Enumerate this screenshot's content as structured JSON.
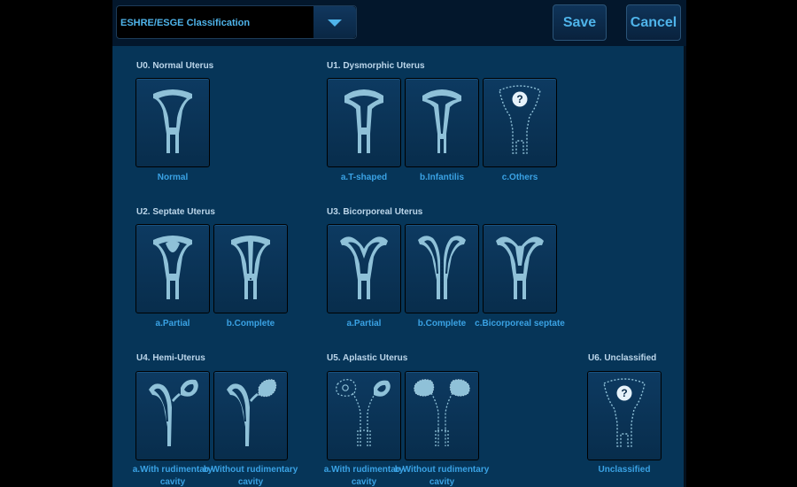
{
  "header": {
    "classification_select": "ESHRE/ESGE Classification",
    "save_label": "Save",
    "cancel_label": "Cancel"
  },
  "groups": {
    "u0": {
      "title": "U0. Normal Uterus",
      "items": [
        {
          "label": "Normal",
          "icon": "normal-uterus-icon"
        }
      ]
    },
    "u1": {
      "title": "U1. Dysmorphic Uterus",
      "items": [
        {
          "label": "a.T-shaped",
          "icon": "t-shaped-uterus-icon"
        },
        {
          "label": "b.Infantilis",
          "icon": "infantilis-uterus-icon"
        },
        {
          "label": "c.Others",
          "icon": "unknown-uterus-icon"
        }
      ]
    },
    "u2": {
      "title": "U2. Septate Uterus",
      "items": [
        {
          "label": "a.Partial",
          "icon": "partial-septate-uterus-icon"
        },
        {
          "label": "b.Complete",
          "icon": "complete-septate-uterus-icon"
        }
      ]
    },
    "u3": {
      "title": "U3. Bicorporeal Uterus",
      "items": [
        {
          "label": "a.Partial",
          "icon": "partial-bicorporeal-uterus-icon"
        },
        {
          "label": "b.Complete",
          "icon": "complete-bicorporeal-uterus-icon"
        },
        {
          "label": "c.Bicorporeal septate",
          "icon": "bicorporeal-septate-uterus-icon"
        }
      ]
    },
    "u4": {
      "title": "U4. Hemi-Uterus",
      "items": [
        {
          "label": "a.With rudimentary cavity",
          "icon": "hemi-uterus-with-cavity-icon"
        },
        {
          "label": "b.Without rudimentary cavity",
          "icon": "hemi-uterus-without-cavity-icon"
        }
      ]
    },
    "u5": {
      "title": "U5. Aplastic Uterus",
      "items": [
        {
          "label": "a.With rudimentary cavity",
          "icon": "aplastic-with-cavity-icon"
        },
        {
          "label": "b.Without rudimentary cavity",
          "icon": "aplastic-without-cavity-icon"
        }
      ]
    },
    "u6": {
      "title": "U6. Unclassified",
      "items": [
        {
          "label": "Unclassified",
          "icon": "unclassified-uterus-icon"
        }
      ]
    }
  },
  "colors": {
    "panel": "#063558",
    "icon_fill": "#8fc1d8",
    "caption": "#3aa2e4",
    "title": "#bcd6ea"
  }
}
